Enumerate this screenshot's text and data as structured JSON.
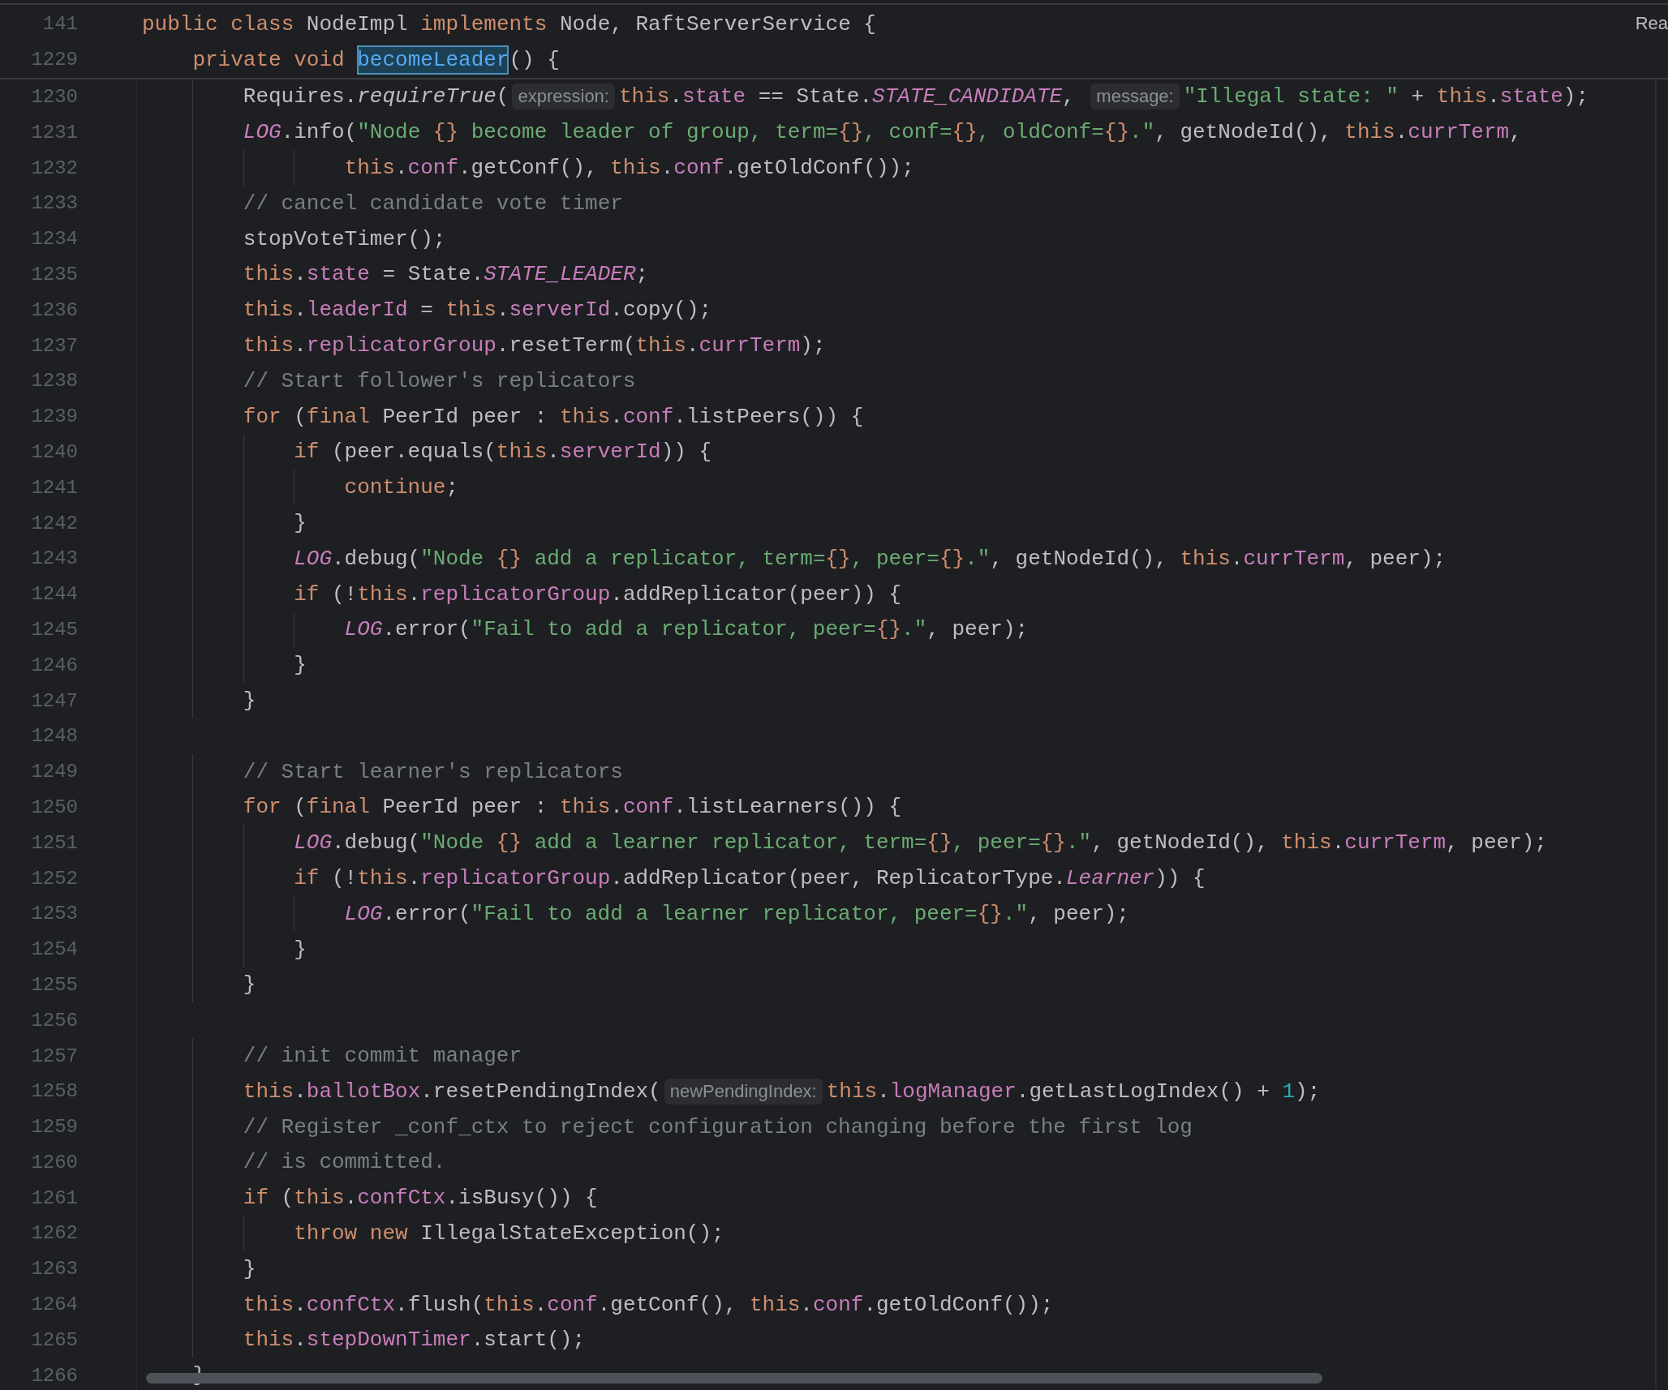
{
  "reader_mode_label": "Rea",
  "sticky_lines": [
    {
      "number": "141",
      "tokens": [
        {
          "kind": "kw",
          "text": "public class"
        },
        {
          "kind": "plain",
          "text": " NodeImpl "
        },
        {
          "kind": "kw",
          "text": "implements"
        },
        {
          "kind": "plain",
          "text": " Node, RaftServerService {"
        }
      ]
    },
    {
      "number": "1229",
      "tokens": [
        {
          "kind": "kw",
          "text": "    private void "
        },
        {
          "kind": "selection",
          "text": "becomeLeader"
        },
        {
          "kind": "plain",
          "text": "() {"
        }
      ]
    }
  ],
  "lines": [
    {
      "number": "1230",
      "tokens": [
        {
          "kind": "plain",
          "text": "        Requires."
        },
        {
          "kind": "static",
          "text": "requireTrue"
        },
        {
          "kind": "plain",
          "text": "("
        },
        {
          "kind": "hint",
          "text": "expression:"
        },
        {
          "kind": "kw",
          "text": "this"
        },
        {
          "kind": "plain",
          "text": "."
        },
        {
          "kind": "field",
          "text": "state"
        },
        {
          "kind": "plain",
          "text": " == State."
        },
        {
          "kind": "const",
          "text": "STATE_CANDIDATE"
        },
        {
          "kind": "plain",
          "text": ", "
        },
        {
          "kind": "hint",
          "text": "message:"
        },
        {
          "kind": "str",
          "text": "\"Illegal state: \""
        },
        {
          "kind": "plain",
          "text": " + "
        },
        {
          "kind": "kw",
          "text": "this"
        },
        {
          "kind": "plain",
          "text": "."
        },
        {
          "kind": "field",
          "text": "state"
        },
        {
          "kind": "plain",
          "text": ");"
        }
      ]
    },
    {
      "number": "1231",
      "tokens": [
        {
          "kind": "const",
          "text": "        LOG"
        },
        {
          "kind": "plain",
          "text": ".info("
        },
        {
          "kind": "str",
          "text": "\"Node "
        },
        {
          "kind": "fmt",
          "text": "{}"
        },
        {
          "kind": "str",
          "text": " become leader of group, term="
        },
        {
          "kind": "fmt",
          "text": "{}"
        },
        {
          "kind": "str",
          "text": ", conf="
        },
        {
          "kind": "fmt",
          "text": "{}"
        },
        {
          "kind": "str",
          "text": ", oldConf="
        },
        {
          "kind": "fmt",
          "text": "{}"
        },
        {
          "kind": "str",
          "text": ".\""
        },
        {
          "kind": "plain",
          "text": ", getNodeId(), "
        },
        {
          "kind": "kw",
          "text": "this"
        },
        {
          "kind": "plain",
          "text": "."
        },
        {
          "kind": "field",
          "text": "currTerm"
        },
        {
          "kind": "plain",
          "text": ","
        }
      ]
    },
    {
      "number": "1232",
      "tokens": [
        {
          "kind": "kw",
          "text": "                this"
        },
        {
          "kind": "plain",
          "text": "."
        },
        {
          "kind": "field",
          "text": "conf"
        },
        {
          "kind": "plain",
          "text": ".getConf(), "
        },
        {
          "kind": "kw",
          "text": "this"
        },
        {
          "kind": "plain",
          "text": "."
        },
        {
          "kind": "field",
          "text": "conf"
        },
        {
          "kind": "plain",
          "text": ".getOldConf());"
        }
      ]
    },
    {
      "number": "1233",
      "tokens": [
        {
          "kind": "comment",
          "text": "        // cancel candidate vote timer"
        }
      ]
    },
    {
      "number": "1234",
      "tokens": [
        {
          "kind": "plain",
          "text": "        stopVoteTimer();"
        }
      ]
    },
    {
      "number": "1235",
      "tokens": [
        {
          "kind": "kw",
          "text": "        this"
        },
        {
          "kind": "plain",
          "text": "."
        },
        {
          "kind": "field",
          "text": "state"
        },
        {
          "kind": "plain",
          "text": " = State."
        },
        {
          "kind": "const",
          "text": "STATE_LEADER"
        },
        {
          "kind": "plain",
          "text": ";"
        }
      ]
    },
    {
      "number": "1236",
      "tokens": [
        {
          "kind": "kw",
          "text": "        this"
        },
        {
          "kind": "plain",
          "text": "."
        },
        {
          "kind": "field",
          "text": "leaderId"
        },
        {
          "kind": "plain",
          "text": " = "
        },
        {
          "kind": "kw",
          "text": "this"
        },
        {
          "kind": "plain",
          "text": "."
        },
        {
          "kind": "field",
          "text": "serverId"
        },
        {
          "kind": "plain",
          "text": ".copy();"
        }
      ]
    },
    {
      "number": "1237",
      "tokens": [
        {
          "kind": "kw",
          "text": "        this"
        },
        {
          "kind": "plain",
          "text": "."
        },
        {
          "kind": "field",
          "text": "replicatorGroup"
        },
        {
          "kind": "plain",
          "text": ".resetTerm("
        },
        {
          "kind": "kw",
          "text": "this"
        },
        {
          "kind": "plain",
          "text": "."
        },
        {
          "kind": "field",
          "text": "currTerm"
        },
        {
          "kind": "plain",
          "text": ");"
        }
      ]
    },
    {
      "number": "1238",
      "tokens": [
        {
          "kind": "comment",
          "text": "        // Start follower's replicators"
        }
      ]
    },
    {
      "number": "1239",
      "tokens": [
        {
          "kind": "kw",
          "text": "        for"
        },
        {
          "kind": "plain",
          "text": " ("
        },
        {
          "kind": "kw",
          "text": "final"
        },
        {
          "kind": "plain",
          "text": " PeerId peer : "
        },
        {
          "kind": "kw",
          "text": "this"
        },
        {
          "kind": "plain",
          "text": "."
        },
        {
          "kind": "field",
          "text": "conf"
        },
        {
          "kind": "plain",
          "text": ".listPeers()) {"
        }
      ]
    },
    {
      "number": "1240",
      "tokens": [
        {
          "kind": "kw",
          "text": "            if"
        },
        {
          "kind": "plain",
          "text": " (peer.equals("
        },
        {
          "kind": "kw",
          "text": "this"
        },
        {
          "kind": "plain",
          "text": "."
        },
        {
          "kind": "field",
          "text": "serverId"
        },
        {
          "kind": "plain",
          "text": ")) {"
        }
      ]
    },
    {
      "number": "1241",
      "tokens": [
        {
          "kind": "kw",
          "text": "                continue"
        },
        {
          "kind": "plain",
          "text": ";"
        }
      ]
    },
    {
      "number": "1242",
      "tokens": [
        {
          "kind": "plain",
          "text": "            }"
        }
      ]
    },
    {
      "number": "1243",
      "tokens": [
        {
          "kind": "const",
          "text": "            LOG"
        },
        {
          "kind": "plain",
          "text": ".debug("
        },
        {
          "kind": "str",
          "text": "\"Node "
        },
        {
          "kind": "fmt",
          "text": "{}"
        },
        {
          "kind": "str",
          "text": " add a replicator, term="
        },
        {
          "kind": "fmt",
          "text": "{}"
        },
        {
          "kind": "str",
          "text": ", peer="
        },
        {
          "kind": "fmt",
          "text": "{}"
        },
        {
          "kind": "str",
          "text": ".\""
        },
        {
          "kind": "plain",
          "text": ", getNodeId(), "
        },
        {
          "kind": "kw",
          "text": "this"
        },
        {
          "kind": "plain",
          "text": "."
        },
        {
          "kind": "field",
          "text": "currTerm"
        },
        {
          "kind": "plain",
          "text": ", peer);"
        }
      ]
    },
    {
      "number": "1244",
      "tokens": [
        {
          "kind": "kw",
          "text": "            if"
        },
        {
          "kind": "plain",
          "text": " (!"
        },
        {
          "kind": "kw",
          "text": "this"
        },
        {
          "kind": "plain",
          "text": "."
        },
        {
          "kind": "field",
          "text": "replicatorGroup"
        },
        {
          "kind": "plain",
          "text": ".addReplicator(peer)) {"
        }
      ]
    },
    {
      "number": "1245",
      "tokens": [
        {
          "kind": "const",
          "text": "                LOG"
        },
        {
          "kind": "plain",
          "text": ".error("
        },
        {
          "kind": "str",
          "text": "\"Fail to add a replicator, peer="
        },
        {
          "kind": "fmt",
          "text": "{}"
        },
        {
          "kind": "str",
          "text": ".\""
        },
        {
          "kind": "plain",
          "text": ", peer);"
        }
      ]
    },
    {
      "number": "1246",
      "tokens": [
        {
          "kind": "plain",
          "text": "            }"
        }
      ]
    },
    {
      "number": "1247",
      "tokens": [
        {
          "kind": "plain",
          "text": "        }"
        }
      ]
    },
    {
      "number": "1248"
    },
    {
      "number": "1249",
      "tokens": [
        {
          "kind": "comment",
          "text": "        // Start learner's replicators"
        }
      ]
    },
    {
      "number": "1250",
      "tokens": [
        {
          "kind": "kw",
          "text": "        for"
        },
        {
          "kind": "plain",
          "text": " ("
        },
        {
          "kind": "kw",
          "text": "final"
        },
        {
          "kind": "plain",
          "text": " PeerId peer : "
        },
        {
          "kind": "kw",
          "text": "this"
        },
        {
          "kind": "plain",
          "text": "."
        },
        {
          "kind": "field",
          "text": "conf"
        },
        {
          "kind": "plain",
          "text": ".listLearners()) {"
        }
      ]
    },
    {
      "number": "1251",
      "tokens": [
        {
          "kind": "const",
          "text": "            LOG"
        },
        {
          "kind": "plain",
          "text": ".debug("
        },
        {
          "kind": "str",
          "text": "\"Node "
        },
        {
          "kind": "fmt",
          "text": "{}"
        },
        {
          "kind": "str",
          "text": " add a learner replicator, term="
        },
        {
          "kind": "fmt",
          "text": "{}"
        },
        {
          "kind": "str",
          "text": ", peer="
        },
        {
          "kind": "fmt",
          "text": "{}"
        },
        {
          "kind": "str",
          "text": ".\""
        },
        {
          "kind": "plain",
          "text": ", getNodeId(), "
        },
        {
          "kind": "kw",
          "text": "this"
        },
        {
          "kind": "plain",
          "text": "."
        },
        {
          "kind": "field",
          "text": "currTerm"
        },
        {
          "kind": "plain",
          "text": ", peer);"
        }
      ]
    },
    {
      "number": "1252",
      "tokens": [
        {
          "kind": "kw",
          "text": "            if"
        },
        {
          "kind": "plain",
          "text": " (!"
        },
        {
          "kind": "kw",
          "text": "this"
        },
        {
          "kind": "plain",
          "text": "."
        },
        {
          "kind": "field",
          "text": "replicatorGroup"
        },
        {
          "kind": "plain",
          "text": ".addReplicator(peer, ReplicatorType."
        },
        {
          "kind": "const",
          "text": "Learner"
        },
        {
          "kind": "plain",
          "text": ")) {"
        }
      ]
    },
    {
      "number": "1253",
      "tokens": [
        {
          "kind": "const",
          "text": "                LOG"
        },
        {
          "kind": "plain",
          "text": ".error("
        },
        {
          "kind": "str",
          "text": "\"Fail to add a learner replicator, peer="
        },
        {
          "kind": "fmt",
          "text": "{}"
        },
        {
          "kind": "str",
          "text": ".\""
        },
        {
          "kind": "plain",
          "text": ", peer);"
        }
      ]
    },
    {
      "number": "1254",
      "tokens": [
        {
          "kind": "plain",
          "text": "            }"
        }
      ]
    },
    {
      "number": "1255",
      "tokens": [
        {
          "kind": "plain",
          "text": "        }"
        }
      ]
    },
    {
      "number": "1256"
    },
    {
      "number": "1257",
      "tokens": [
        {
          "kind": "comment",
          "text": "        // init commit manager"
        }
      ]
    },
    {
      "number": "1258",
      "tokens": [
        {
          "kind": "kw",
          "text": "        this"
        },
        {
          "kind": "plain",
          "text": "."
        },
        {
          "kind": "field",
          "text": "ballotBox"
        },
        {
          "kind": "plain",
          "text": ".resetPendingIndex("
        },
        {
          "kind": "hint",
          "text": "newPendingIndex:"
        },
        {
          "kind": "kw",
          "text": "this"
        },
        {
          "kind": "plain",
          "text": "."
        },
        {
          "kind": "field",
          "text": "logManager"
        },
        {
          "kind": "plain",
          "text": ".getLastLogIndex() + "
        },
        {
          "kind": "num",
          "text": "1"
        },
        {
          "kind": "plain",
          "text": ");"
        }
      ]
    },
    {
      "number": "1259",
      "tokens": [
        {
          "kind": "comment",
          "text": "        // Register _conf_ctx to reject configuration changing before the first log"
        }
      ]
    },
    {
      "number": "1260",
      "tokens": [
        {
          "kind": "comment",
          "text": "        // is committed."
        }
      ]
    },
    {
      "number": "1261",
      "tokens": [
        {
          "kind": "kw",
          "text": "        if"
        },
        {
          "kind": "plain",
          "text": " ("
        },
        {
          "kind": "kw",
          "text": "this"
        },
        {
          "kind": "plain",
          "text": "."
        },
        {
          "kind": "field",
          "text": "confCtx"
        },
        {
          "kind": "plain",
          "text": ".isBusy()) {"
        }
      ]
    },
    {
      "number": "1262",
      "tokens": [
        {
          "kind": "kw",
          "text": "            throw new"
        },
        {
          "kind": "plain",
          "text": " IllegalStateException();"
        }
      ]
    },
    {
      "number": "1263",
      "tokens": [
        {
          "kind": "plain",
          "text": "        }"
        }
      ]
    },
    {
      "number": "1264",
      "tokens": [
        {
          "kind": "kw",
          "text": "        this"
        },
        {
          "kind": "plain",
          "text": "."
        },
        {
          "kind": "field",
          "text": "confCtx"
        },
        {
          "kind": "plain",
          "text": ".flush("
        },
        {
          "kind": "kw",
          "text": "this"
        },
        {
          "kind": "plain",
          "text": "."
        },
        {
          "kind": "field",
          "text": "conf"
        },
        {
          "kind": "plain",
          "text": ".getConf(), "
        },
        {
          "kind": "kw",
          "text": "this"
        },
        {
          "kind": "plain",
          "text": "."
        },
        {
          "kind": "field",
          "text": "conf"
        },
        {
          "kind": "plain",
          "text": ".getOldConf());"
        }
      ]
    },
    {
      "number": "1265",
      "tokens": [
        {
          "kind": "kw",
          "text": "        this"
        },
        {
          "kind": "plain",
          "text": "."
        },
        {
          "kind": "field",
          "text": "stepDownTimer"
        },
        {
          "kind": "plain",
          "text": ".start();"
        }
      ]
    },
    {
      "number": "1266",
      "tokens": [
        {
          "kind": "plain",
          "text": "    }"
        }
      ]
    }
  ]
}
